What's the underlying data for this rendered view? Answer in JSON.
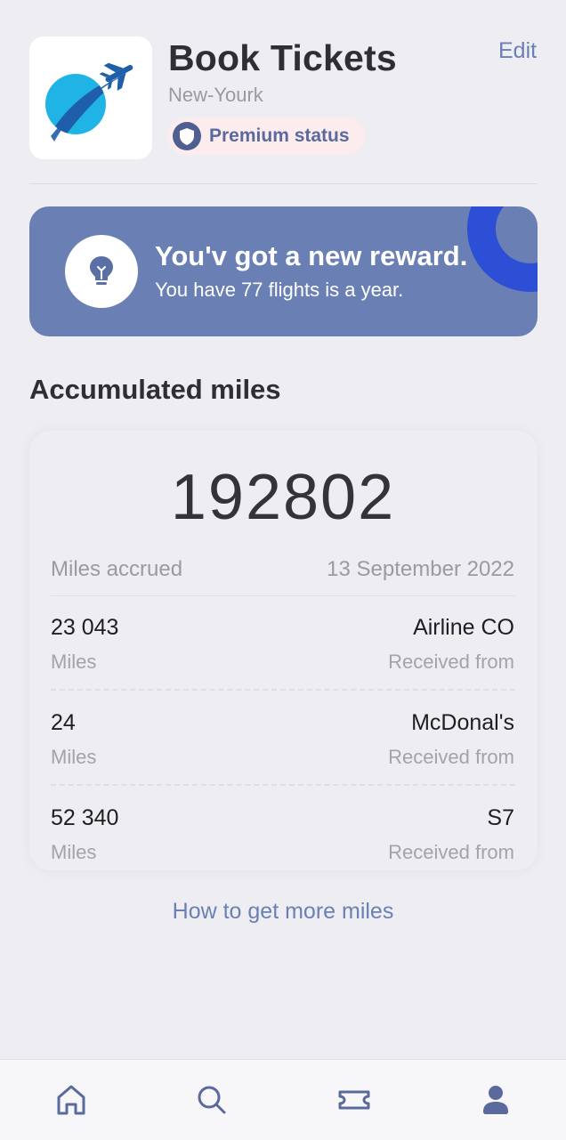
{
  "header": {
    "title": "Book Tickets",
    "city": "New-Yourk",
    "edit_label": "Edit",
    "status_label": "Premium status"
  },
  "reward": {
    "title": "You'v got a new reward.",
    "subtitle": "You have 77 flights is a year."
  },
  "miles": {
    "section_title": "Accumulated miles",
    "total": "192802",
    "accrued_label": "Miles accrued",
    "accrued_date": "13 September 2022",
    "entries": [
      {
        "amount": "23 043",
        "unit": "Miles",
        "source": "Airline CO",
        "received_label": "Received from"
      },
      {
        "amount": "24",
        "unit": "Miles",
        "source": "McDonal's",
        "received_label": "Received from"
      },
      {
        "amount": "52 340",
        "unit": "Miles",
        "source": "S7",
        "received_label": "Received from"
      }
    ],
    "more_link": "How to get more miles"
  },
  "nav": {
    "items": [
      {
        "icon": "home-icon"
      },
      {
        "icon": "search-icon"
      },
      {
        "icon": "ticket-icon"
      },
      {
        "icon": "profile-icon"
      }
    ]
  },
  "colors": {
    "background": "#eeedf2",
    "accent": "#6a80b5",
    "accent_dark": "#2c4fd6",
    "logo_cyan": "#1fb3e6",
    "logo_blue": "#1f5ea8",
    "badge_bg": "#fcecee"
  }
}
